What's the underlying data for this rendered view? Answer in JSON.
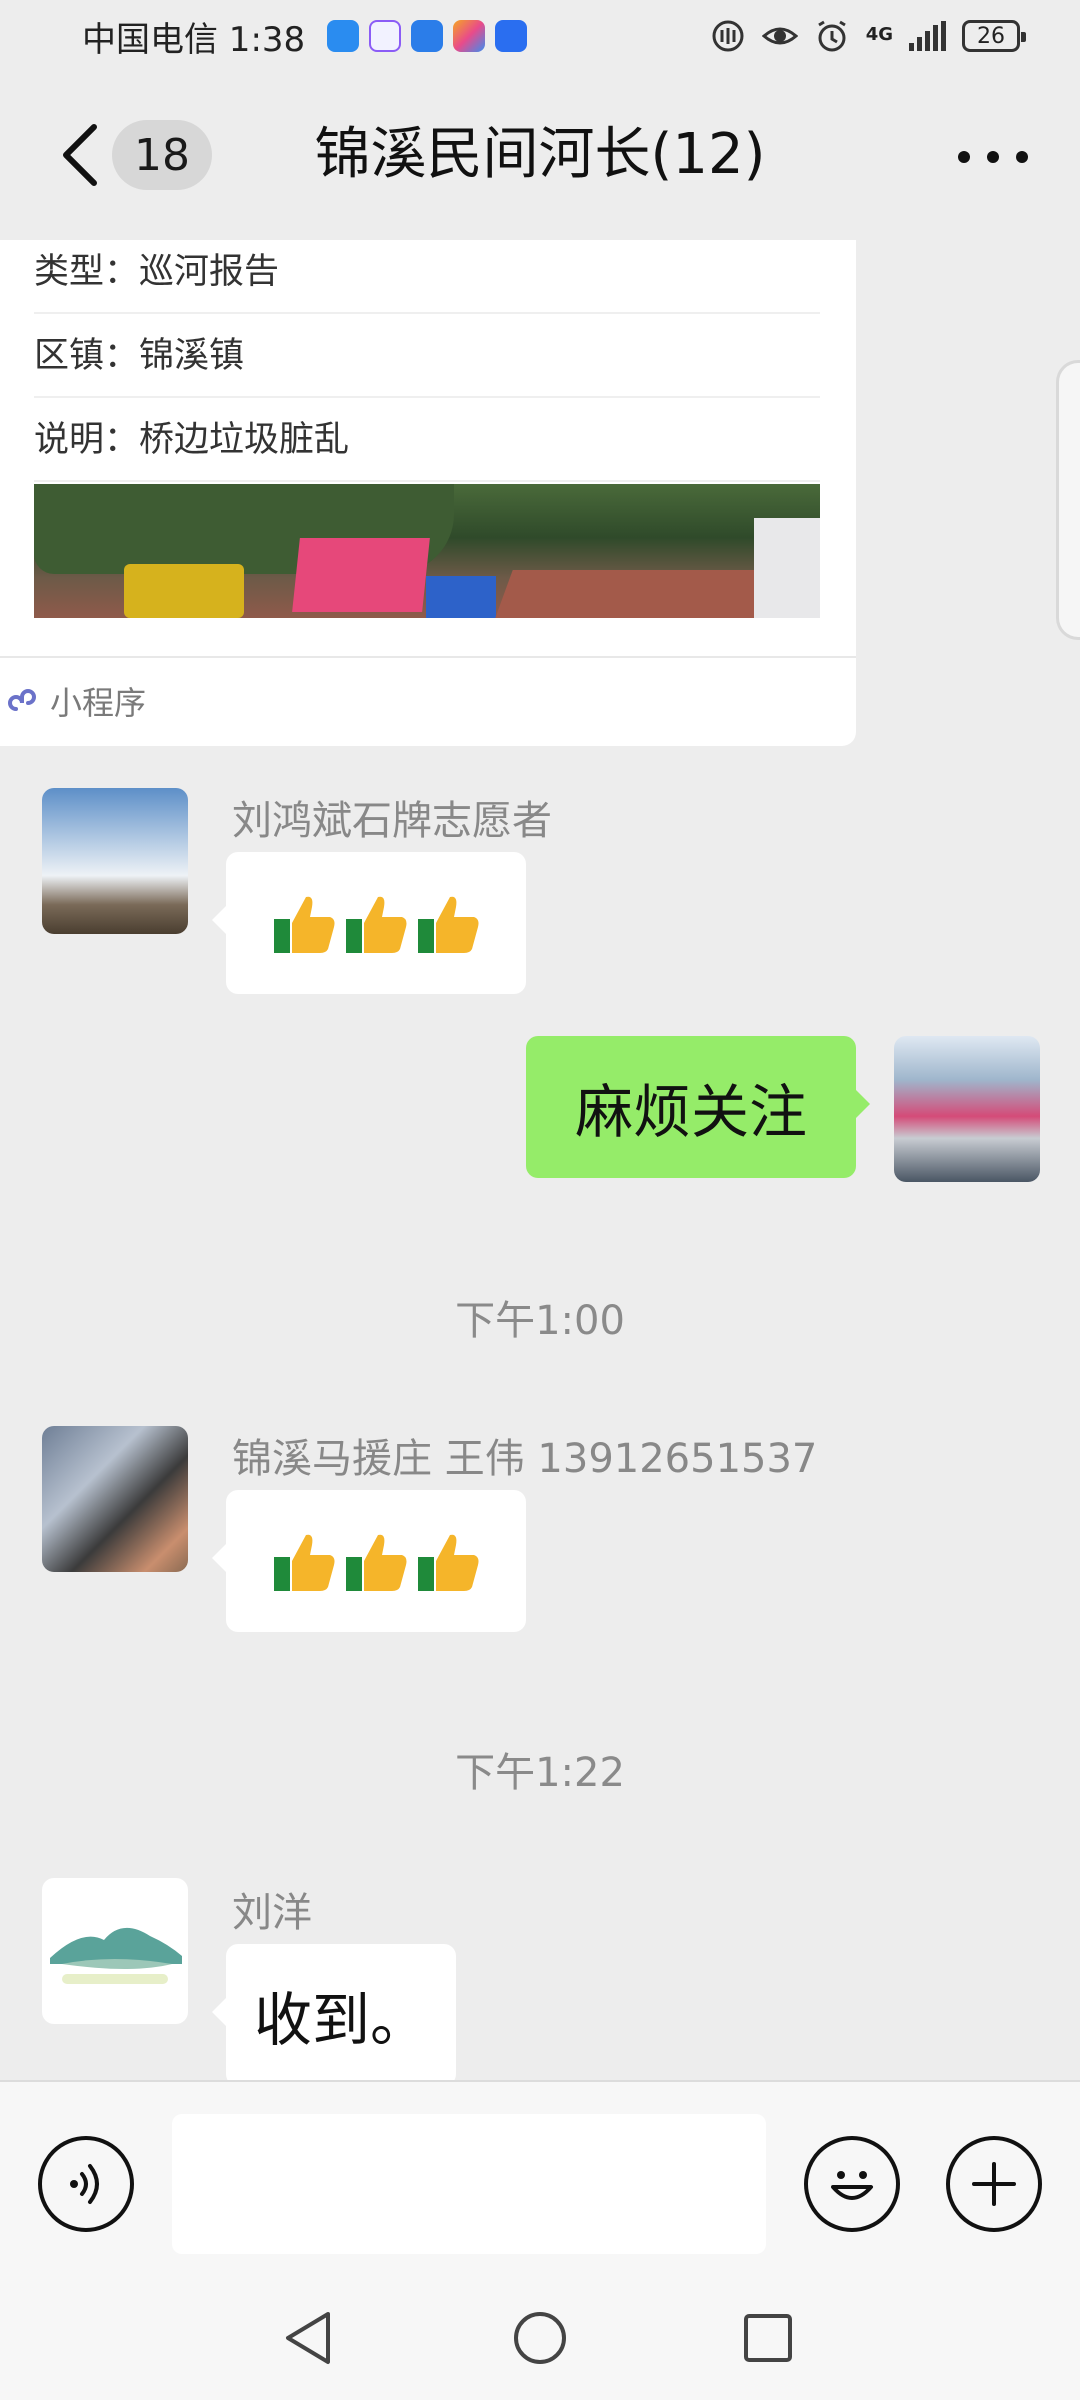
{
  "status_bar": {
    "carrier_time": "中国电信 1:38",
    "network_label": "4G",
    "battery": "26",
    "app_icon_colors": [
      "#2a8cf0",
      "#8b5cf6",
      "#2b7de9",
      "#f5a623",
      "#2a6ef0"
    ]
  },
  "header": {
    "unread_count": "18",
    "title": "锦溪民间河长(12)"
  },
  "mini_program_card": {
    "rows": [
      {
        "label": "类型",
        "value": "巡河报告",
        "text": "类型：巡河报告"
      },
      {
        "label": "区镇",
        "value": "锦溪镇",
        "text": "区镇：锦溪镇"
      },
      {
        "label": "说明",
        "value": "桥边垃圾脏乱",
        "text": "说明：桥边垃圾脏乱"
      }
    ],
    "footer_label": "小程序"
  },
  "messages": [
    {
      "side": "left",
      "sender": "刘鸿斌石牌志愿者",
      "type": "emoji",
      "emoji": "thumbs-up",
      "count": 3
    },
    {
      "side": "right",
      "type": "text",
      "text": "麻烦关注"
    },
    {
      "type": "timestamp",
      "text": "下午1:00"
    },
    {
      "side": "left",
      "sender": "锦溪马援庄 王伟 13912651537",
      "type": "emoji",
      "emoji": "thumbs-up",
      "count": 3
    },
    {
      "type": "timestamp",
      "text": "下午1:22"
    },
    {
      "side": "left",
      "sender": "刘洋",
      "type": "text",
      "text": "收到。"
    }
  ],
  "input": {
    "placeholder": "",
    "value": ""
  },
  "colors": {
    "background": "#ededed",
    "self_bubble": "#95ec69",
    "other_bubble": "#ffffff"
  }
}
